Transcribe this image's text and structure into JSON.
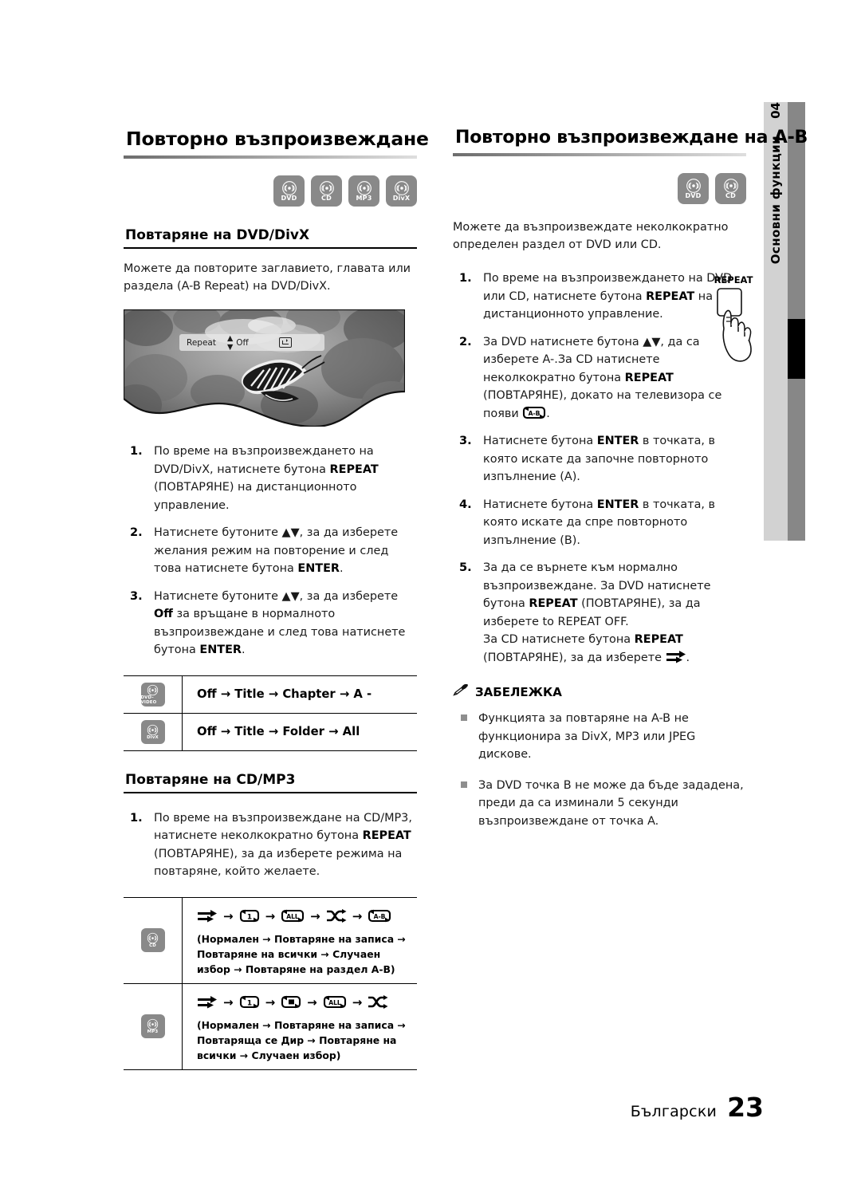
{
  "side_tab": {
    "chapter_number": "04",
    "chapter_label": "Основни функции"
  },
  "left_column": {
    "section_title": "Повторно възпроизвеждане",
    "disc_badges": [
      "DVD",
      "CD",
      "MP3",
      "DivX"
    ],
    "subsection_1": {
      "title": "Повтаряне на DVD/DivX",
      "intro": "Можете да повторите заглавието, главата или раздела (A-B Repeat) на DVD/DivX.",
      "screenshot_osd": {
        "label": "Repeat",
        "value": "Off",
        "updown_icon": "up-down-arrow-icon",
        "enter_icon": "enter-key-icon"
      },
      "steps": [
        {
          "num": "1.",
          "parts": [
            {
              "t": "По време на възпроизвеждането на DVD/DivX, натиснете бутона ",
              "b": false
            },
            {
              "t": "REPEAT",
              "b": true
            },
            {
              "t": " (ПОВТАРЯНЕ) на дистанционното управление.",
              "b": false
            }
          ]
        },
        {
          "num": "2.",
          "parts": [
            {
              "t": "Натиснете бутоните ▲▼, за да изберете желания режим на повторение и след това натиснете бутона ",
              "b": false
            },
            {
              "t": "ENTER",
              "b": true
            },
            {
              "t": ".",
              "b": false
            }
          ]
        },
        {
          "num": "3.",
          "parts": [
            {
              "t": "Натиснете бутоните ▲▼, за да изберете ",
              "b": false
            },
            {
              "t": "Off",
              "b": true
            },
            {
              "t": " за връщане в нормалното възпроизвеждане и след това натиснете бутона ",
              "b": false
            },
            {
              "t": "ENTER",
              "b": true
            },
            {
              "t": ".",
              "b": false
            }
          ]
        }
      ],
      "mode_table": [
        {
          "disc": "DVD-VIDEO",
          "sequence": "Off → Title → Chapter → A -"
        },
        {
          "disc": "DivX",
          "sequence": "Off → Title → Folder → All"
        }
      ]
    },
    "subsection_2": {
      "title": "Повтаряне на CD/MP3",
      "steps": [
        {
          "num": "1.",
          "parts": [
            {
              "t": "По време на възпроизвеждане на CD/MP3, натиснете неколкократно бутона ",
              "b": false
            },
            {
              "t": "REPEAT",
              "b": true
            },
            {
              "t": " (ПОВТАРЯНЕ), за да изберете режима на повтаряне, който желаете.",
              "b": false
            }
          ]
        }
      ],
      "sequence_table": [
        {
          "disc": "CD",
          "icons": [
            "normal",
            "repeat-one",
            "repeat-all",
            "shuffle",
            "repeat-ab"
          ],
          "description": "(Нормален → Повтаряне на записа → Повтаряне на всички → Случаен избор → Повтаряне на раздел A-B)"
        },
        {
          "disc": "MP3",
          "icons": [
            "normal",
            "repeat-one",
            "repeat-dir",
            "repeat-all",
            "shuffle"
          ],
          "description": "(Нормален → Повтаряне на записа → Повтаряща се Дир → Повтаряне на всички → Случаен избор)"
        }
      ]
    }
  },
  "right_column": {
    "section_title": "Повторно възпроизвеждане на A-B",
    "disc_badges": [
      "DVD",
      "CD"
    ],
    "intro": "Можете да възпроизвеждате неколкократно определен раздел от DVD или CD.",
    "remote_button_label": "REPEAT",
    "steps": [
      {
        "num": "1.",
        "parts": [
          {
            "t": "По време на възпроизвеждането на DVD или CD, натиснете бутона ",
            "b": false
          },
          {
            "t": "REPEAT",
            "b": true
          },
          {
            "t": " на дистанционното управление.",
            "b": false
          }
        ]
      },
      {
        "num": "2.",
        "parts": [
          {
            "t": "За DVD натиснете бутона ▲▼, да са изберете A-.За CD натиснете неколкократно бутона ",
            "b": false
          },
          {
            "t": "REPEAT",
            "b": true
          },
          {
            "t": " (ПОВТАРЯНЕ), докато на телевизора се появи ",
            "b": false
          },
          {
            "t": "[A-B]",
            "b": false,
            "icon": "repeat-ab"
          },
          {
            "t": ".",
            "b": false
          }
        ]
      },
      {
        "num": "3.",
        "parts": [
          {
            "t": "Натиснете бутона ",
            "b": false
          },
          {
            "t": "ENTER",
            "b": true
          },
          {
            "t": " в точката, в която искате да започне повторното изпълнение (A).",
            "b": false
          }
        ]
      },
      {
        "num": "4.",
        "parts": [
          {
            "t": "Натиснете бутона ",
            "b": false
          },
          {
            "t": "ENTER",
            "b": true
          },
          {
            "t": " в точката, в която искате да спре повторното изпълнение (B).",
            "b": false
          }
        ]
      },
      {
        "num": "5.",
        "parts": [
          {
            "t": "За да се върнете към нормално възпроизвеждане. За DVD натиснете бутона ",
            "b": false
          },
          {
            "t": "REPEAT",
            "b": true
          },
          {
            "t": " (ПОВТАРЯНЕ), за да изберете to REPEAT OFF.\nЗа CD натиснете бутона ",
            "b": false
          },
          {
            "t": "REPEAT",
            "b": true
          },
          {
            "t": " (ПОВТАРЯНЕ), за да изберете ",
            "b": false
          },
          {
            "t": "[normal]",
            "b": false,
            "icon": "normal"
          },
          {
            "t": ".",
            "b": false
          }
        ]
      }
    ],
    "note": {
      "icon": "pencil-icon",
      "title": "ЗАБЕЛЕЖКА",
      "items": [
        "Функцията за повтаряне на A-B не функционира за DivX, MP3 или JPEG дискове.",
        "За DVD точка B не може да бъде зададена, преди да са изминали 5 секунди възпроизвеждане от точка A."
      ]
    }
  },
  "footer": {
    "language": "Български",
    "page_number": "23"
  },
  "colors": {
    "disc_badge_bg": "#898989",
    "side_tab_bg": "#d2d2d2",
    "side_bar_grey": "#878787",
    "side_bar_black": "#000000"
  }
}
